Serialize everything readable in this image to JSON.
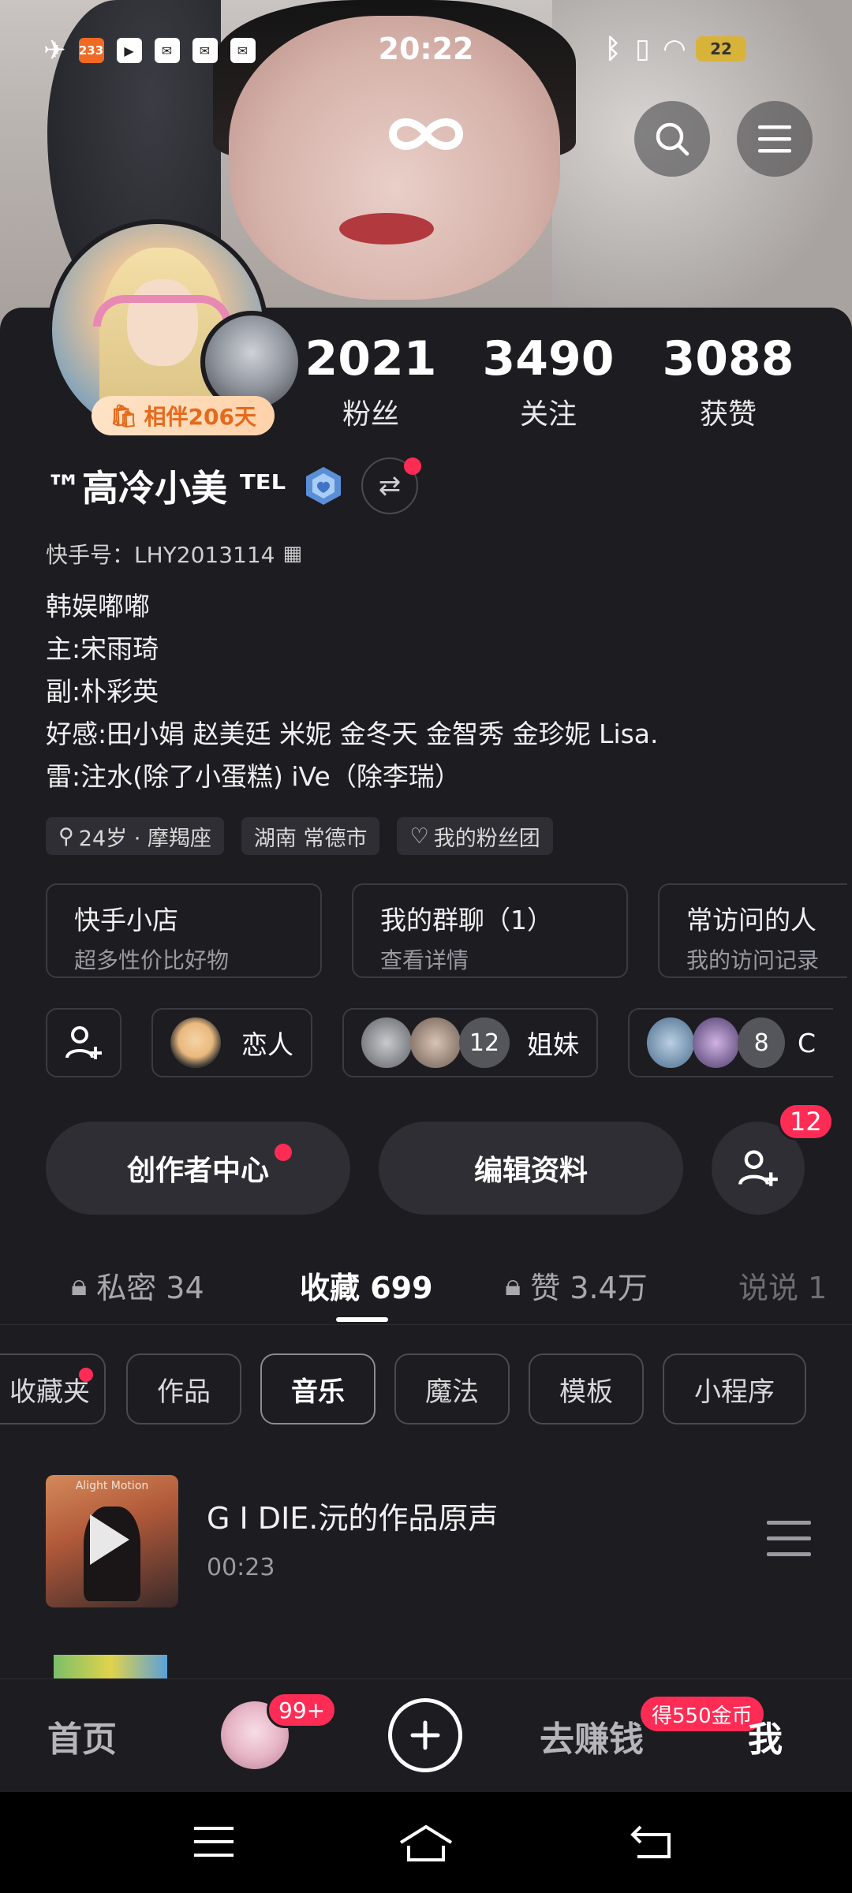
{
  "status_bar": {
    "time": "20:22",
    "left_icons": [
      "airplane-icon",
      "bilibili-icon",
      "app-icon",
      "mail-icon",
      "mail-icon",
      "mail-icon"
    ],
    "bili_label": "233",
    "battery": "22"
  },
  "profile": {
    "name": "™高冷小美 ᵀᴱᴸ",
    "id_label": "快手号：LHY2013114",
    "companion_label": "相伴206天",
    "stats": [
      {
        "value": "2021",
        "label": "粉丝"
      },
      {
        "value": "3490",
        "label": "关注"
      },
      {
        "value": "3088",
        "label": "获赞"
      }
    ],
    "bio": [
      "韩娱嘟嘟",
      "主:宋雨琦",
      "副:朴彩英",
      "好感:田小娟 赵美廷 米妮 金冬天 金智秀 金珍妮 Lisa.",
      "雷:注水(除了小蛋糕) iVe（除李瑞）"
    ],
    "tags": [
      "24岁 · 摩羯座",
      "湖南 常德市",
      "我的粉丝团"
    ]
  },
  "shortcuts": [
    {
      "title": "快手小店",
      "sub": "超多性价比好物"
    },
    {
      "title": "我的群聊（1）",
      "sub": "查看详情"
    },
    {
      "title": "常访问的人",
      "sub": "我的访问记录"
    }
  ],
  "groups": [
    {
      "label": "恋人"
    },
    {
      "label": "姐妹",
      "count": "12"
    },
    {
      "label": "C",
      "count": "8"
    }
  ],
  "actions": {
    "creator": "创作者中心",
    "edit": "编辑资料",
    "add_badge": "12"
  },
  "tabs": [
    {
      "label": "私密 34",
      "locked": true
    },
    {
      "label": "收藏 699",
      "locked": false,
      "active": true
    },
    {
      "label": "赞 3.4万",
      "locked": true
    },
    {
      "label": "说说 1",
      "locked": false
    }
  ],
  "chips": [
    "收藏夹",
    "作品",
    "音乐",
    "魔法",
    "模板",
    "小程序"
  ],
  "active_chip": "音乐",
  "song": {
    "title": "G I DIE.沅的作品原声",
    "duration": "00:23",
    "cover_text": "Alight Motion"
  },
  "bottom_nav": {
    "home": "首页",
    "avatar_badge": "99+",
    "earn": "去赚钱",
    "coin_badge": "得550金币",
    "me": "我"
  },
  "colors": {
    "background": "#1c1c21",
    "accent_red": "#fe2c55",
    "companion_orange": "#e46a1d"
  }
}
